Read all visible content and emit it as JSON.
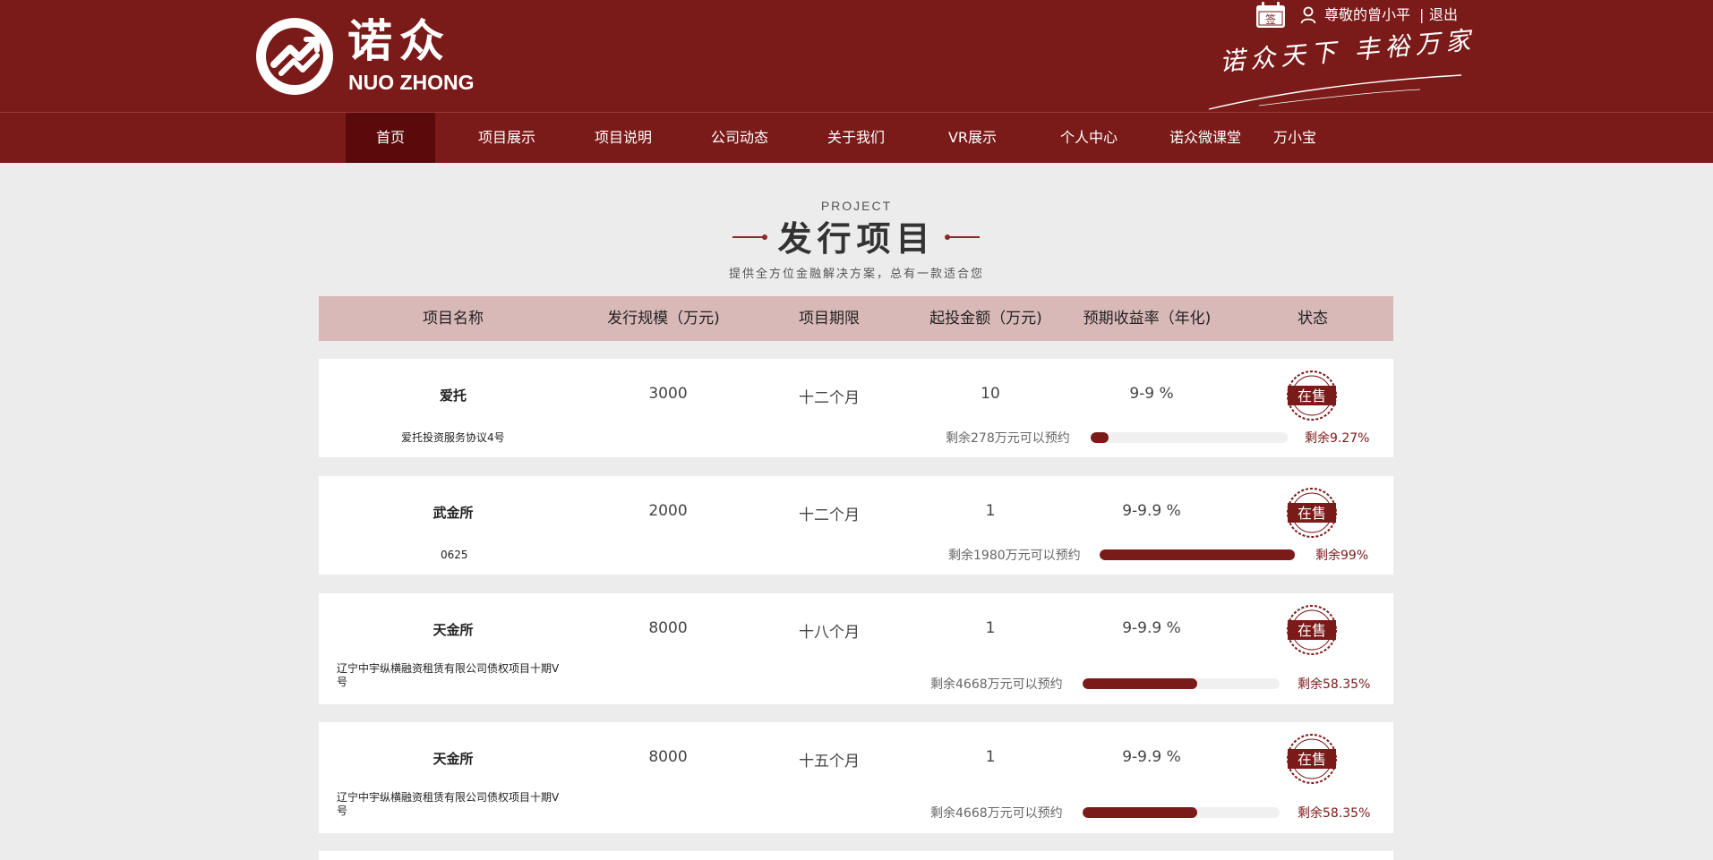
{
  "header": {
    "brand_cn": "诺众",
    "brand_en": "NUO ZHONG",
    "calendar_label": "签",
    "user_name": "尊敬的曾小平",
    "separator": "|",
    "logout": "退出",
    "slogan": "诺众天下 丰裕万家"
  },
  "nav": [
    {
      "label": "首页",
      "active": true
    },
    {
      "label": "项目展示"
    },
    {
      "label": "项目说明"
    },
    {
      "label": "公司动态"
    },
    {
      "label": "关于我们"
    },
    {
      "label": "VR展示"
    },
    {
      "label": "个人中心"
    },
    {
      "label": "诺众微课堂"
    },
    {
      "label": "万小宝"
    }
  ],
  "section": {
    "en": "PROJECT",
    "title": "发行项目",
    "subtitle": "提供全方位金融解决方案，总有一款适合您"
  },
  "table": {
    "headers": [
      "项目名称",
      "发行规模（万元)",
      "项目期限",
      "起投金额（万元)",
      "预期收益率（年化)",
      "状态"
    ],
    "rows": [
      {
        "name": "爱托",
        "scale": "3000",
        "term": "十二个月",
        "min": "10",
        "rate": "9-9 %",
        "status": "在售",
        "desc": "爱托投资服务协议4号",
        "remain": "剩余278万元可以预约",
        "progress": 0.0927,
        "pct": "剩余9.27%"
      },
      {
        "name": "武金所",
        "scale": "2000",
        "term": "十二个月",
        "min": "1",
        "rate": "9-9.9 %",
        "status": "在售",
        "desc": "0625",
        "remain": "剩余1980万元可以预约",
        "progress": 0.99,
        "pct": "剩余99%"
      },
      {
        "name": "天金所",
        "scale": "8000",
        "term": "十八个月",
        "min": "1",
        "rate": "9-9.9 %",
        "status": "在售",
        "desc": "辽宁中宇纵横融资租赁有限公司债权项目十期Ⅴ号",
        "remain": "剩余4668万元可以预约",
        "progress": 0.5835,
        "pct": "剩余58.35%"
      },
      {
        "name": "天金所",
        "scale": "8000",
        "term": "十五个月",
        "min": "1",
        "rate": "9-9.9 %",
        "status": "在售",
        "desc": "辽宁中宇纵横融资租赁有限公司债权项目十期Ⅴ号",
        "remain": "剩余4668万元可以预约",
        "progress": 0.5835,
        "pct": "剩余58.35%"
      }
    ]
  },
  "colors": {
    "brand": "#7a1a19",
    "nav_active": "#5a0a0a",
    "table_header": "#d9b9b8",
    "background": "#ececec"
  }
}
